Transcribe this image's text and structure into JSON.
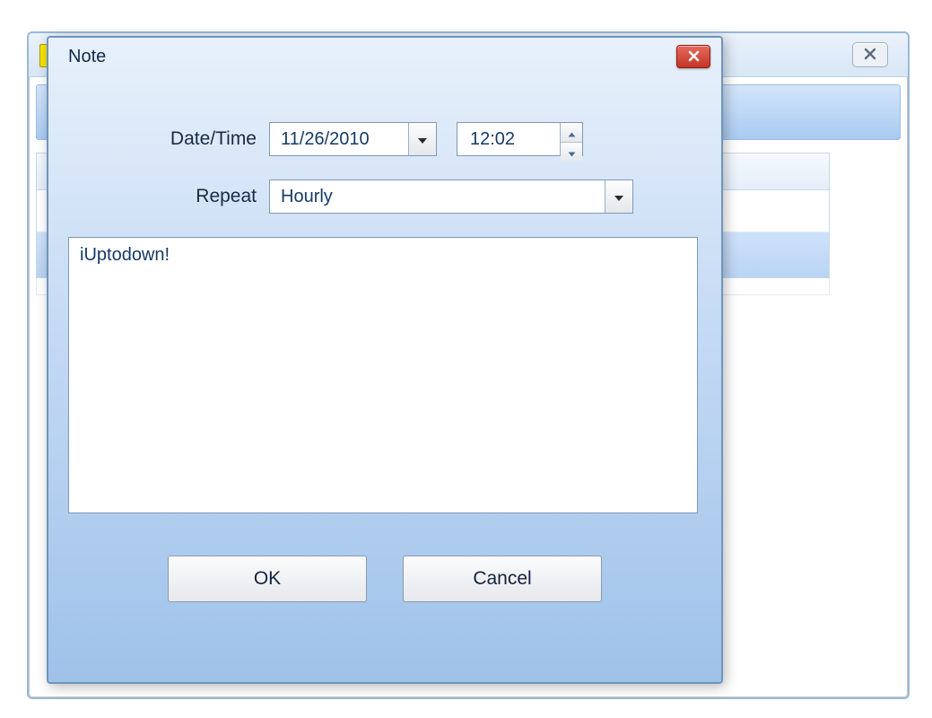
{
  "dialog": {
    "title": "Note",
    "date_time_label": "Date/Time",
    "date_value": "11/26/2010",
    "time_value": "12:02",
    "repeat_label": "Repeat",
    "repeat_value": "Hourly",
    "note_text": "iUptodown!",
    "ok_label": "OK",
    "cancel_label": "Cancel"
  }
}
